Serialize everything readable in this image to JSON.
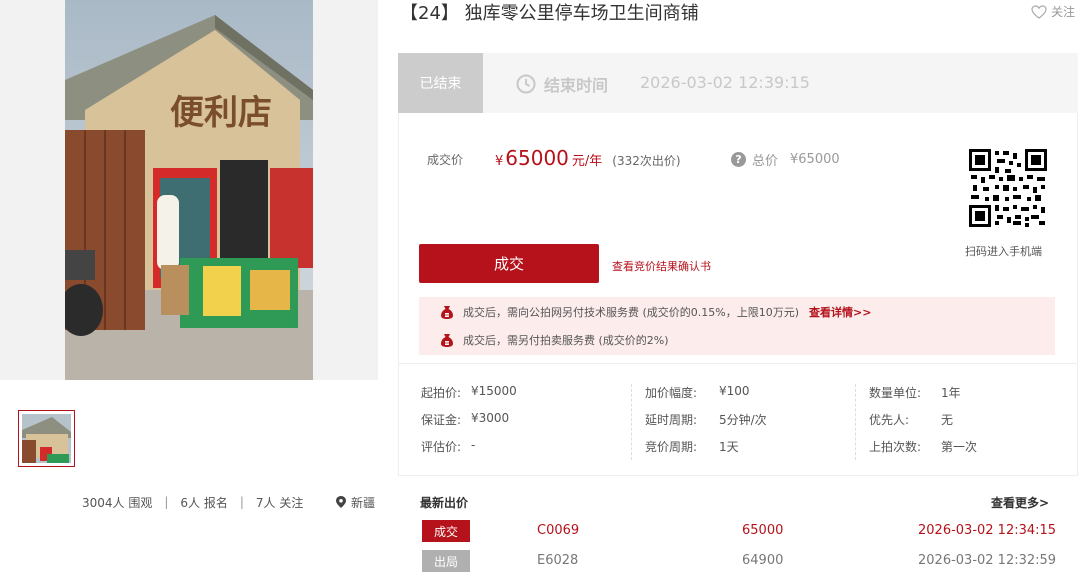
{
  "listing": {
    "title": "【24】 独库零公里停车场卫生间商铺",
    "follow_label": "关注",
    "photo_sign_text": "便利店"
  },
  "stats": {
    "views": "3004人 围观",
    "signups": "6人 报名",
    "follows": "7人 关注",
    "location": "新疆",
    "separator": "|"
  },
  "status": {
    "tag": "已结束",
    "end_label": "结束时间",
    "end_time": "2026-03-02 12:39:15"
  },
  "price": {
    "deal_label": "成交价",
    "currency": "¥",
    "amount": "65000",
    "unit": "元/年",
    "bid_count": "(332次出价)",
    "total_label": "总价",
    "total_value": "¥65000",
    "qr_caption": "扫码进入手机端",
    "deal_button": "成交",
    "confirm_link": "查看竞价结果确认书"
  },
  "fees": {
    "line1": "成交后，需向公拍网另付技术服务费 (成交价的0.15%，上限10万元)",
    "line1_link": "查看详情>>",
    "line2": "成交后，需另付拍卖服务费 (成交价的2%)"
  },
  "params": {
    "col1": [
      {
        "k": "起拍价:",
        "v": "¥15000"
      },
      {
        "k": "保证金:",
        "v": "¥3000"
      },
      {
        "k": "评估价:",
        "v": "-"
      }
    ],
    "col2": [
      {
        "k": "加价幅度:",
        "v": "¥100"
      },
      {
        "k": "延时周期:",
        "v": "5分钟/次"
      },
      {
        "k": "竞价周期:",
        "v": "1天"
      }
    ],
    "col3": [
      {
        "k": "数量单位:",
        "v": "1年"
      },
      {
        "k": "优先人:",
        "v": "无"
      },
      {
        "k": "上拍次数:",
        "v": "第一次"
      }
    ]
  },
  "bids": {
    "title": "最新出价",
    "more": "查看更多>",
    "rows": [
      {
        "status": "成交",
        "code": "C0069",
        "amount": "65000",
        "time": "2026-03-02 12:34:15"
      },
      {
        "status": "出局",
        "code": "E6028",
        "amount": "64900",
        "time": "2026-03-02 12:32:59"
      }
    ]
  },
  "colors": {
    "accent": "#b5121b",
    "muted": "#cccccc",
    "fee_bg": "#fcecec"
  }
}
